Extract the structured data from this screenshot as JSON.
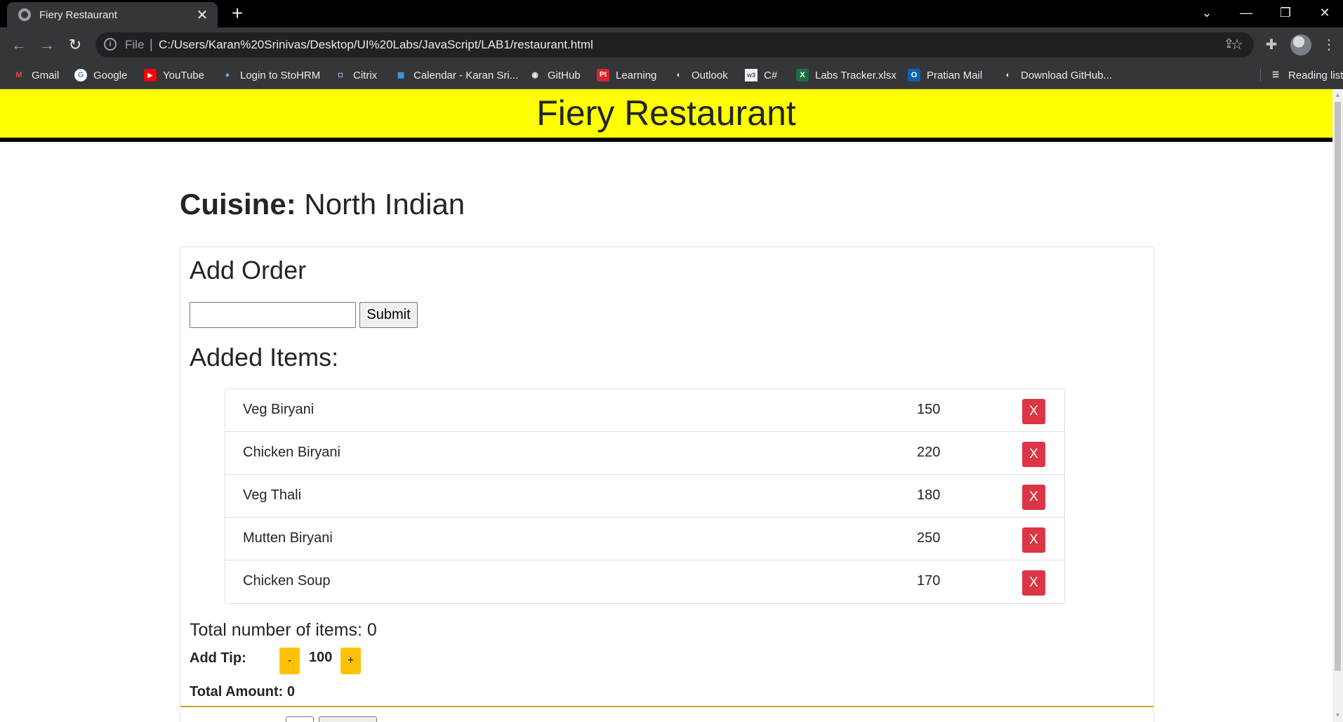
{
  "browser": {
    "tab_title": "Fiery Restaurant",
    "tab_close": "✕",
    "new_tab": "+",
    "file_label": "File",
    "separator": "|",
    "url": "C:/Users/Karan%20Srinivas/Desktop/UI%20Labs/JavaScript/LAB1/restaurant.html",
    "bookmarks": [
      {
        "label": "Gmail",
        "icon": "gmail-icon",
        "color": "#ea4335",
        "glyph": "M"
      },
      {
        "label": "Google",
        "icon": "google-icon",
        "color": "#4285f4",
        "glyph": "G"
      },
      {
        "label": "YouTube",
        "icon": "youtube-icon",
        "color": "#ff0000",
        "glyph": "▶"
      },
      {
        "label": "Login to StoHRM",
        "icon": "stohrm-icon",
        "color": "#1e63b6",
        "glyph": "●"
      },
      {
        "label": "Citrix",
        "icon": "citrix-icon",
        "color": "#4a90e2",
        "glyph": "◘"
      },
      {
        "label": "Calendar - Karan Sri...",
        "icon": "calendar-icon",
        "color": "#0078d4",
        "glyph": "▦"
      },
      {
        "label": "GitHub",
        "icon": "github-icon",
        "color": "#6e7681",
        "glyph": "◉"
      },
      {
        "label": "Learning",
        "icon": "learning-icon",
        "color": "#d9262e",
        "glyph": "Pt"
      },
      {
        "label": "Outlook",
        "icon": "outlook-icon",
        "color": "#6e7681",
        "glyph": "◐"
      },
      {
        "label": "C#",
        "icon": "w3-icon",
        "color": "#f2f2f2",
        "glyph": "w3"
      },
      {
        "label": "Labs Tracker.xlsx",
        "icon": "excel-icon",
        "color": "#1d6f42",
        "glyph": "X"
      },
      {
        "label": "Pratian Mail",
        "icon": "outlook-mail-icon",
        "color": "#0a64ad",
        "glyph": "O"
      },
      {
        "label": "Download GitHub...",
        "icon": "download-icon",
        "color": "#6e7681",
        "glyph": "◐"
      }
    ],
    "reading_list": "Reading list"
  },
  "header": {
    "title": "Fiery Restaurant"
  },
  "cuisine": {
    "label": "Cuisine:",
    "value": "North Indian"
  },
  "order": {
    "heading": "Add Order",
    "input_value": "",
    "submit_label": "Submit",
    "added_heading": "Added Items:",
    "items": [
      {
        "name": "Veg Biryani",
        "price": "150",
        "remove": "X"
      },
      {
        "name": "Chicken Biryani",
        "price": "220",
        "remove": "X"
      },
      {
        "name": "Veg Thali",
        "price": "180",
        "remove": "X"
      },
      {
        "name": "Mutten Biryani",
        "price": "250",
        "remove": "X"
      },
      {
        "name": "Chicken Soup",
        "price": "170",
        "remove": "X"
      }
    ],
    "total_items": "Total number of items: 0",
    "tip_label": "Add Tip:",
    "tip_minus": "-",
    "tip_value": "100",
    "tip_plus": "+",
    "total_amount": "Total Amount: 0"
  },
  "colors": {
    "header_bg": "#ffff00",
    "remove_button": "#dc3545",
    "tip_button": "#ffc107",
    "divider": "#c8a415"
  }
}
